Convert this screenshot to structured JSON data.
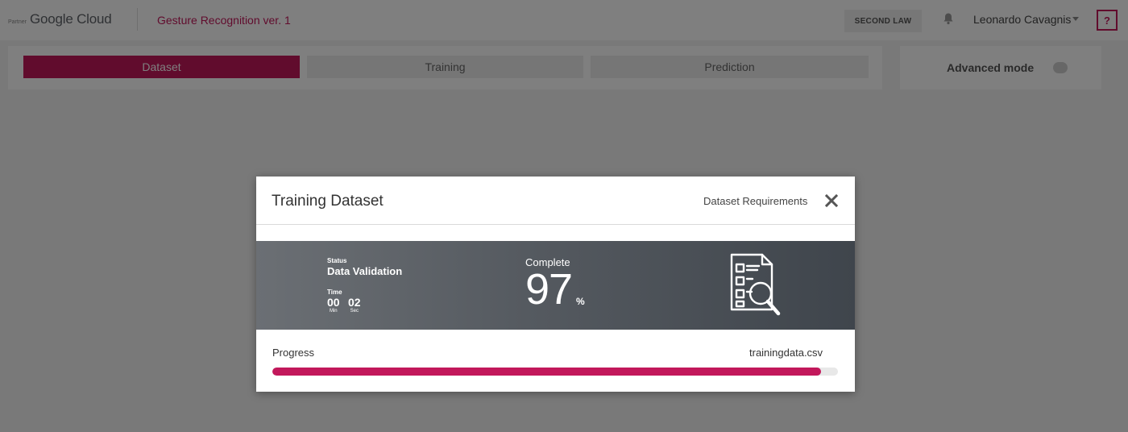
{
  "header": {
    "partner_label": "Partner",
    "logo_text": "Google Cloud",
    "app_title": "Gesture Recognition ver. 1",
    "second_law_label": "SECOND LAW",
    "user_name": "Leonardo Cavagnis",
    "help_label": "?",
    "icons": {
      "notifications": "bell-icon",
      "user_menu": "chevron-down-icon"
    }
  },
  "tabs": [
    {
      "label": "Dataset",
      "active": true
    },
    {
      "label": "Training",
      "active": false
    },
    {
      "label": "Prediction",
      "active": false
    }
  ],
  "advanced_mode": {
    "label": "Advanced mode",
    "enabled": false
  },
  "modal": {
    "title": "Training Dataset",
    "requirements_link": "Dataset Requirements",
    "close_icon": "close-icon",
    "status": {
      "status_label": "Status",
      "status_value": "Data Validation",
      "time_label": "Time",
      "minutes": "00",
      "minutes_unit": "Min",
      "seconds": "02",
      "seconds_unit": "Sec"
    },
    "completion": {
      "label": "Complete",
      "value": "97",
      "unit": "%"
    },
    "status_icon": "document-search-icon",
    "progress": {
      "label": "Progress",
      "file_name": "trainingdata.csv",
      "fraction": 0.97
    }
  },
  "colors": {
    "accent": "#c2185b",
    "status_band_dark": "#3f454c",
    "overlay": "rgba(0,0,0,0.5)"
  }
}
